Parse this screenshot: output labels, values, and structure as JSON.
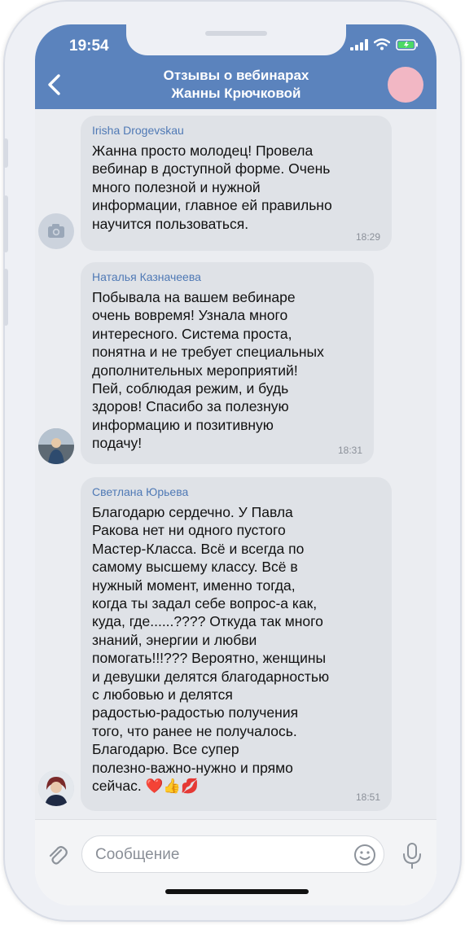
{
  "status_bar": {
    "time": "19:54"
  },
  "header": {
    "title_line1": "Отзывы о вебинарах",
    "title_line2": "Жанны Крючковой"
  },
  "messages": [
    {
      "sender": "Irisha Drogevskau",
      "lines": [
        "Жанна просто молодец! Провела",
        "вебинар в доступной форме. Очень",
        "много полезной и нужной",
        "информации, главное ей правильно",
        "научится пользоваться."
      ],
      "time": "18:29"
    },
    {
      "sender": "Наталья Казначеева",
      "lines": [
        "Побывала на вашем вебинаре",
        "очень вовремя! Узнала много",
        "интересного. Система проста,",
        "понятна и не требует специальных",
        "дополнительных мероприятий!",
        "Пей, соблюдая режим, и будь",
        "здоров! Спасибо за полезную",
        "информацию и позитивную",
        "подачу!"
      ],
      "time": "18:31"
    },
    {
      "sender": "Светлана Юрьева",
      "lines": [
        "Благодарю сердечно. У Павла",
        "Ракова нет ни одного пустого",
        "Мастер-Класса. Всё и всегда по",
        "самому высшему классу. Всё в",
        "нужный момент, именно тогда,",
        "когда ты задал себе вопрос-а как,",
        "куда, где......???? Откуда так много",
        "знаний, энергии и любви",
        "помогать!!!??? Вероятно, женщины",
        "и девушки делятся благодарностью",
        "с любовью и делятся",
        "радостью-радостью получения",
        "того, что ранее не получалось.",
        "Благодарю. Все супер",
        "полезно-важно-нужно и прямо",
        "сейчас. ❤️👍💋"
      ],
      "time": "18:51"
    }
  ],
  "composer": {
    "placeholder": "Сообщение"
  },
  "icons": {
    "back": "chevron-left-icon",
    "camera": "camera-icon",
    "attach": "paperclip-icon",
    "emoji": "smiley-icon",
    "mic": "microphone-icon"
  },
  "colors": {
    "header": "#5b83bd",
    "bubble": "#dfe2e7",
    "sender": "#4f79b5"
  }
}
